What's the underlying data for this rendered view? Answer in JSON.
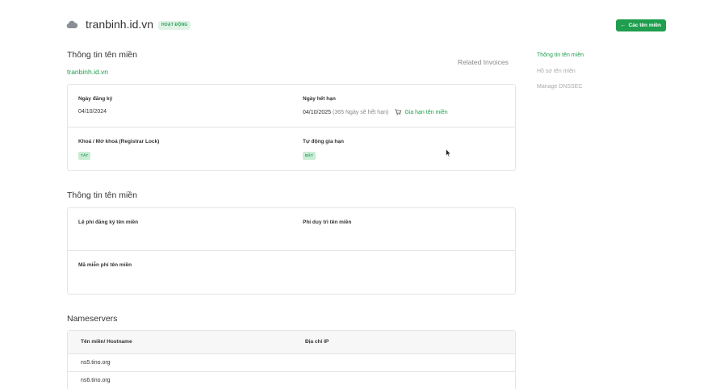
{
  "header": {
    "domain": "tranbinh.id.vn",
    "status": "HOẠT ĐỘNG",
    "back_button": "Các tên miền"
  },
  "domain_info": {
    "title": "Thông tin tên miền",
    "domain_link": "tranbinh.id.vn",
    "related_invoices": "Related Invoices",
    "registration_label": "Ngày đăng ký",
    "registration_date": "04/10/2024",
    "expiry_label": "Ngày hết hạn",
    "expiry_date": "04/10/2025",
    "expiry_note": "(365 Ngày sẽ hết hạn)",
    "renew_label": "Gia hạn tên miền",
    "lock_label": "Khoá / Mở khoá (Registrar Lock)",
    "lock_status": "TẮT",
    "auto_renew_label": "Tự động gia hạn",
    "auto_renew_status": "BẬT"
  },
  "fees": {
    "title": "Thông tin tên miền",
    "registration_fee_label": "Lệ phí đăng ký tên miền",
    "maintenance_fee_label": "Phí duy trì tên miền",
    "exemption_code_label": "Mã miễn phí tên miền"
  },
  "nameservers": {
    "title": "Nameservers",
    "col_hostname": "Tên miền/ Hostname",
    "col_ip": "Địa chỉ IP",
    "rows": [
      {
        "hostname": "ns5.tino.org",
        "ip": ""
      },
      {
        "hostname": "ns6.tino.org",
        "ip": ""
      }
    ]
  },
  "sidebar": {
    "items": [
      {
        "label": "Thông tin tên miền",
        "active": true
      },
      {
        "label": "Hồ sơ tên miền",
        "active": false
      },
      {
        "label": "Manage DNSSEC",
        "active": false
      }
    ]
  },
  "colors": {
    "accent": "#1e9e4e",
    "badge_bg": "#dff3e5",
    "tag_bg": "#c9ecd4",
    "muted": "#888888"
  },
  "icons": {
    "cloud": "cloud-icon",
    "cart": "cart-icon",
    "back": "arrow-left-icon",
    "cursor": "mouse-cursor-icon"
  }
}
